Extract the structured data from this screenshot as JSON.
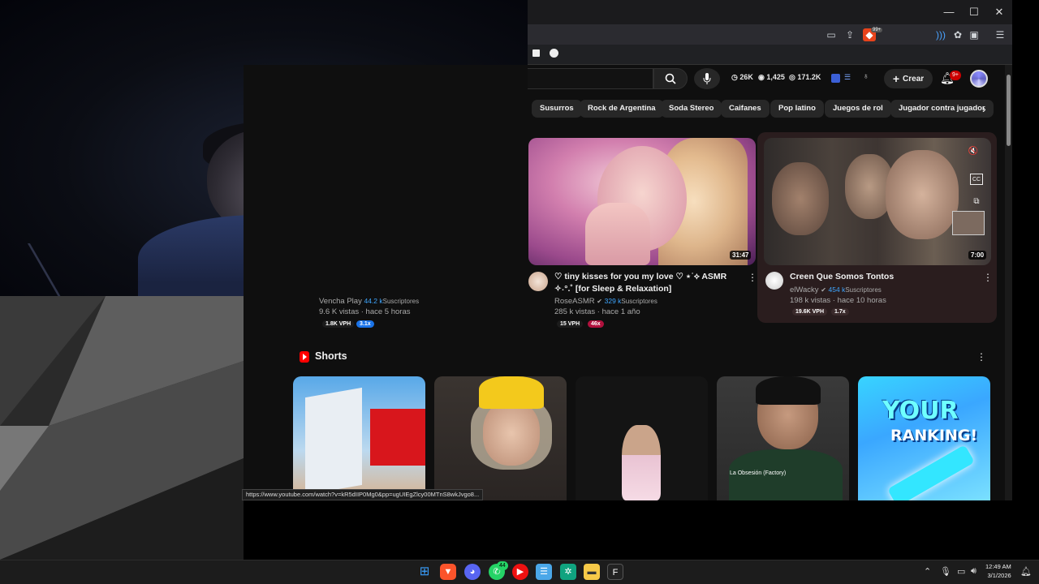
{
  "browser": {
    "window_controls": {
      "minimize": "—",
      "maximize": "☐",
      "close": "✕"
    },
    "toolbar_icons": [
      "cast-icon",
      "share-icon",
      "brave-shield-icon",
      "extension-icon",
      "puzzle-icon",
      "sidebar-icon",
      "menu-icon"
    ],
    "shield_badge": "99+"
  },
  "youtube": {
    "stats": {
      "views": "26K",
      "online": "1,425",
      "watching": "171.2K"
    },
    "create_label": "Crear",
    "notif_badge": "9+",
    "chips": [
      "Susurros",
      "Rock de Argentina",
      "Soda Stereo",
      "Caifanes",
      "Pop latino",
      "Juegos de rol",
      "Jugador contra jugador"
    ],
    "prev_card": {
      "channel": "Vencha Play",
      "subs": "44.2 k",
      "subs_label": "Suscriptores",
      "meta": "9.6 K vistas · hace 5 horas",
      "vph": "1.8K VPH",
      "ratio": "3.1x"
    },
    "videos": [
      {
        "title": "♡ tiny kisses for you my love ♡ ⋆˙⟡ ASMR ✧˖°.˚ [for Sleep & Relaxation]",
        "duration": "31:47",
        "channel": "RoseASMR",
        "subs": "329 k",
        "subs_label": "Suscriptores",
        "meta": "285 k vistas · hace 1 año",
        "vph": "15 VPH",
        "ratio": "46x",
        "ratio_color": "#b0113d"
      },
      {
        "title": "Creen Que Somos Tontos",
        "duration": "7:00",
        "channel": "elWacky",
        "subs": "454 k",
        "subs_label": "Suscriptores",
        "meta": "198 k vistas · hace 10 horas",
        "vph": "19.6K VPH",
        "ratio": "1.7x",
        "thumb_overlay": {
          "mute": "🔇",
          "cc": "CC"
        }
      }
    ],
    "shorts_title": "Shorts",
    "shorts": [
      {
        "name": "short-blocks"
      },
      {
        "name": "short-beanie"
      },
      {
        "name": "short-doll"
      },
      {
        "name": "short-portrait",
        "caption": "La Obsesión (Factory)"
      },
      {
        "name": "short-ranking",
        "text1": "YOUR",
        "text2": "RANKING!"
      }
    ]
  },
  "status_url": "https://www.youtube.com/watch?v=kR5dIIP0Mg0&pp=ugUIEgZlcy00MTnS8wkJvgo8...",
  "taskbar": {
    "whatsapp_badge": "44",
    "time": "12:49 AM",
    "date": "3/1/2026"
  }
}
